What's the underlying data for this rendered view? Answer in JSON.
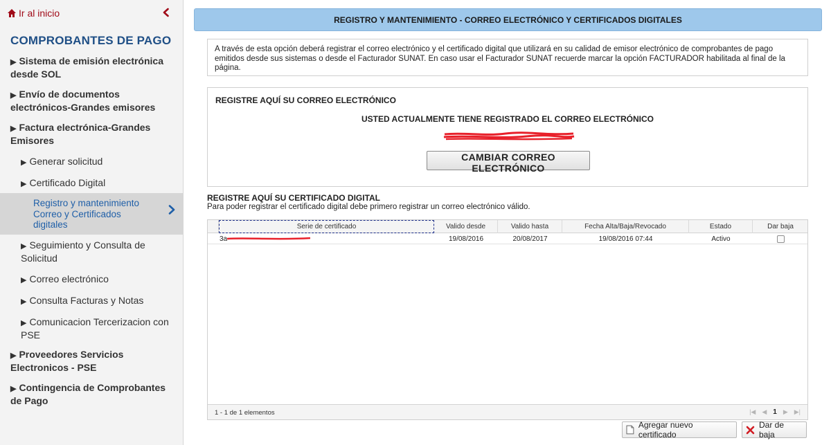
{
  "sidebar": {
    "home_label": "Ir al inicio",
    "section_title": "COMPROBANTES DE PAGO",
    "items": [
      {
        "label": "Sistema de emisión electrónica desde SOL"
      },
      {
        "label": "Envío de documentos electrónicos-Grandes emisores"
      },
      {
        "label": "Factura electrónica-Grandes Emisores"
      },
      {
        "label": "Generar solicitud"
      },
      {
        "label": "Certificado Digital"
      },
      {
        "label": "Registro y mantenimiento Correo y Certificados digitales"
      },
      {
        "label": "Seguimiento y Consulta de Solicitud"
      },
      {
        "label": "Correo electrónico"
      },
      {
        "label": "Consulta Facturas y Notas"
      },
      {
        "label": "Comunicacion Tercerizacion con PSE"
      },
      {
        "label": "Proveedores Servicios Electronicos - PSE"
      },
      {
        "label": "Contingencia de Comprobantes de Pago"
      }
    ]
  },
  "header": {
    "title": "REGISTRO Y MANTENIMIENTO - CORREO ELECTRÓNICO Y CERTIFICADOS DIGITALES"
  },
  "info": {
    "text": "A través de esta opción deberá registrar el correo electrónico y el certificado digital que utilizará en su calidad de emisor electrónico de comprobantes de pago emitidos desde sus sistemas o desde el Facturador SUNAT. En caso usar el Facturador SUNAT recuerde marcar la opción FACTURADOR habilitada al final de la página."
  },
  "email_section": {
    "title": "REGISTRE AQUÍ SU CORREO ELECTRÓNICO",
    "registered_text": "USTED ACTUALMENTE TIENE REGISTRADO EL CORREO ELECTRÓNICO",
    "change_button": "CAMBIAR CORREO ELECTRÓNICO"
  },
  "cert_section": {
    "title": "REGISTRE AQUÍ SU CERTIFICADO DIGITAL",
    "subtitle": "Para poder registrar el certificado digital debe primero registrar un correo electrónico válido.",
    "columns": [
      "Serie de certificado",
      "Valido desde",
      "Valido hasta",
      "Fecha Alta/Baja/Revocado",
      "Estado",
      "Dar baja"
    ],
    "rows": [
      {
        "serie": "3a",
        "valido_desde": "19/08/2016",
        "valido_hasta": "20/08/2017",
        "fecha": "19/08/2016 07:44",
        "estado": "Activo",
        "dar_baja": false
      }
    ],
    "count_text": "1 - 1 de 1 elementos",
    "page": "1",
    "add_button": "Agregar nuevo certificado",
    "remove_button": "Dar de baja"
  },
  "colors": {
    "brand_red": "#a00a18",
    "title_blue": "#1f4f86",
    "header_blue": "#9ec8eb",
    "active_link": "#1f5fa8",
    "redaction_red": "#e8202a"
  },
  "icons": {
    "home": "home-icon",
    "collapse": "chevron-left-icon",
    "active_arrow": "chevron-right-icon",
    "add": "document-icon",
    "remove": "close-x-icon"
  }
}
